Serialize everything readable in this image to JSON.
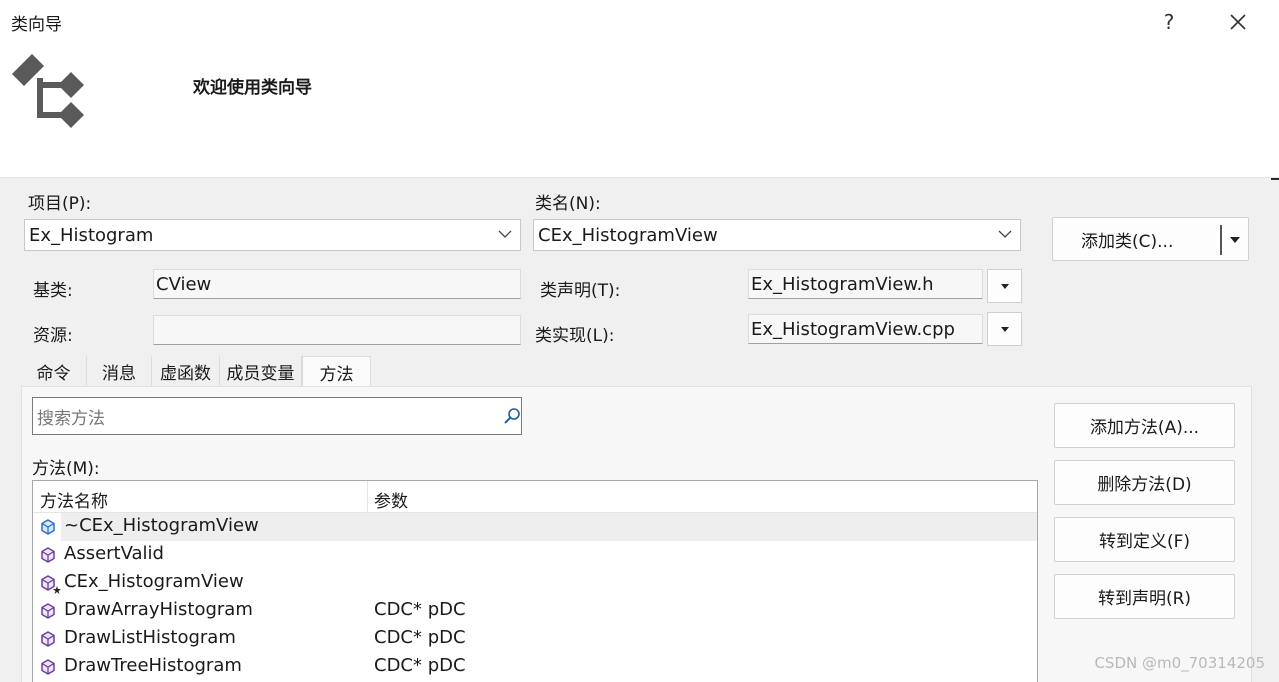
{
  "window": {
    "title": "类向导",
    "help_label": "?",
    "close_label": "✕"
  },
  "header": {
    "welcome": "欢迎使用类向导",
    "logo_icon": "class-wizard-icon"
  },
  "fields": {
    "project_label": "项目(P):",
    "project_value": "Ex_Histogram",
    "classname_label": "类名(N):",
    "classname_value": "CEx_HistogramView",
    "add_class_label": "添加类(C)...",
    "base_label": "基类:",
    "base_value": "CView",
    "resource_label": "资源:",
    "resource_value": "",
    "decl_label": "类声明(T):",
    "decl_value": "Ex_HistogramView.h",
    "impl_label": "类实现(L):",
    "impl_value": "Ex_HistogramView.cpp"
  },
  "tabs": [
    {
      "label": "命令"
    },
    {
      "label": "消息"
    },
    {
      "label": "虚函数"
    },
    {
      "label": "成员变量"
    },
    {
      "label": "方法"
    }
  ],
  "methods": {
    "search_placeholder": "搜索方法",
    "list_label": "方法(M):",
    "col_name": "方法名称",
    "col_params": "参数",
    "rows": [
      {
        "name": "~CEx_HistogramView",
        "params": ""
      },
      {
        "name": "AssertValid",
        "params": ""
      },
      {
        "name": "CEx_HistogramView",
        "params": ""
      },
      {
        "name": "DrawArrayHistogram",
        "params": "CDC* pDC"
      },
      {
        "name": "DrawListHistogram",
        "params": "CDC* pDC"
      },
      {
        "name": "DrawTreeHistogram",
        "params": "CDC* pDC"
      }
    ]
  },
  "actions": {
    "add_method": "添加方法(A)...",
    "delete_method": "删除方法(D)",
    "goto_def": "转到定义(F)",
    "goto_decl": "转到声明(R)"
  },
  "watermark": "CSDN @m0_70314205",
  "colors": {
    "method_icon": "#6a3fa0",
    "selected_icon": "#2a6fcf",
    "search_icon": "#1f5fa8"
  }
}
